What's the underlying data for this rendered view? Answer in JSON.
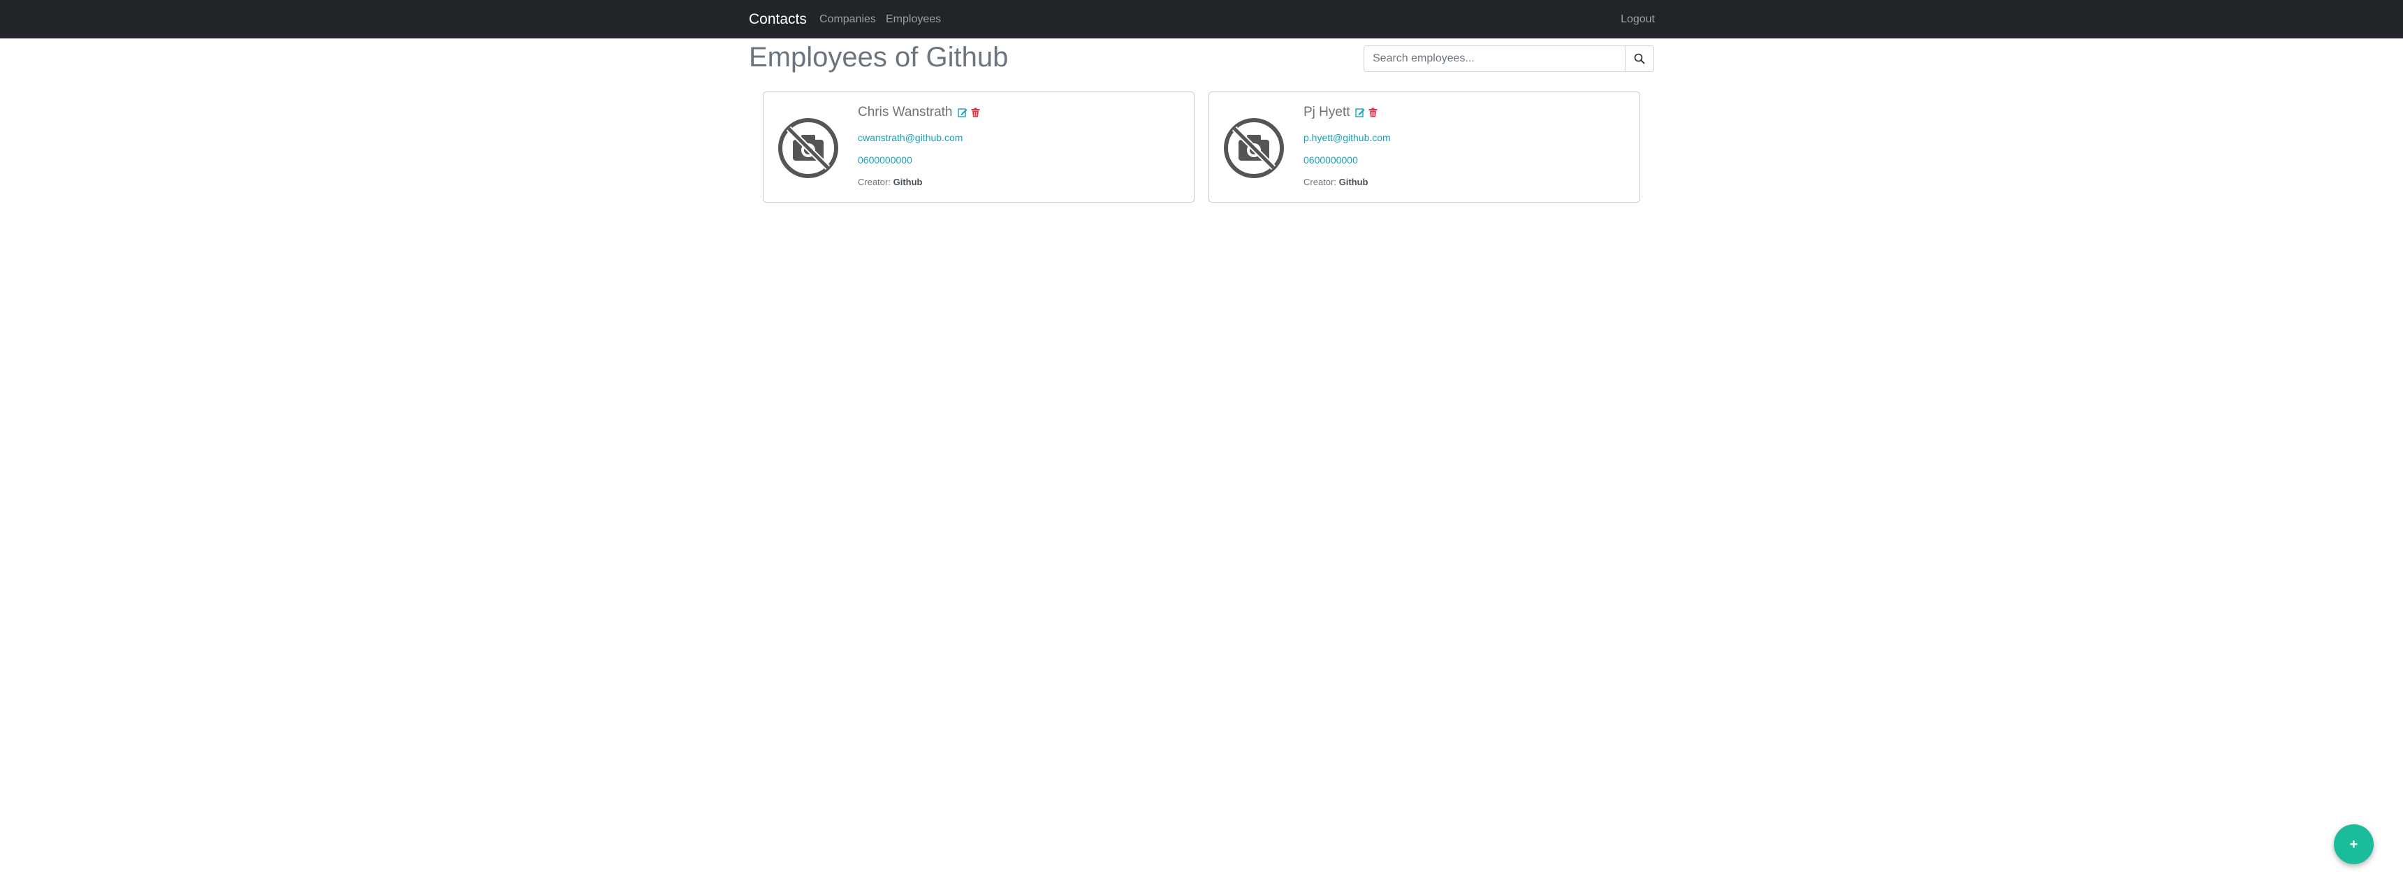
{
  "navbar": {
    "brand": "Contacts",
    "links": [
      "Companies",
      "Employees"
    ],
    "logout": "Logout"
  },
  "page": {
    "title": "Employees of Github"
  },
  "search": {
    "placeholder": "Search employees...",
    "value": "",
    "icon": "search-icon"
  },
  "employees": [
    {
      "name": "Chris Wanstrath",
      "email": "cwanstrath@github.com",
      "phone": "0600000000",
      "creator_label": "Creator:",
      "creator": "Github",
      "avatar_icon": "no-photo-icon"
    },
    {
      "name": "Pj Hyett",
      "email": "p.hyett@github.com",
      "phone": "0600000000",
      "creator_label": "Creator:",
      "creator": "Github",
      "avatar_icon": "no-photo-icon"
    }
  ],
  "fab": {
    "label": "+",
    "color": "#1abc9c"
  },
  "colors": {
    "navbar": "#212529",
    "link": "#17a2b8",
    "edit": "#17a2b8",
    "delete": "#dc3545"
  }
}
